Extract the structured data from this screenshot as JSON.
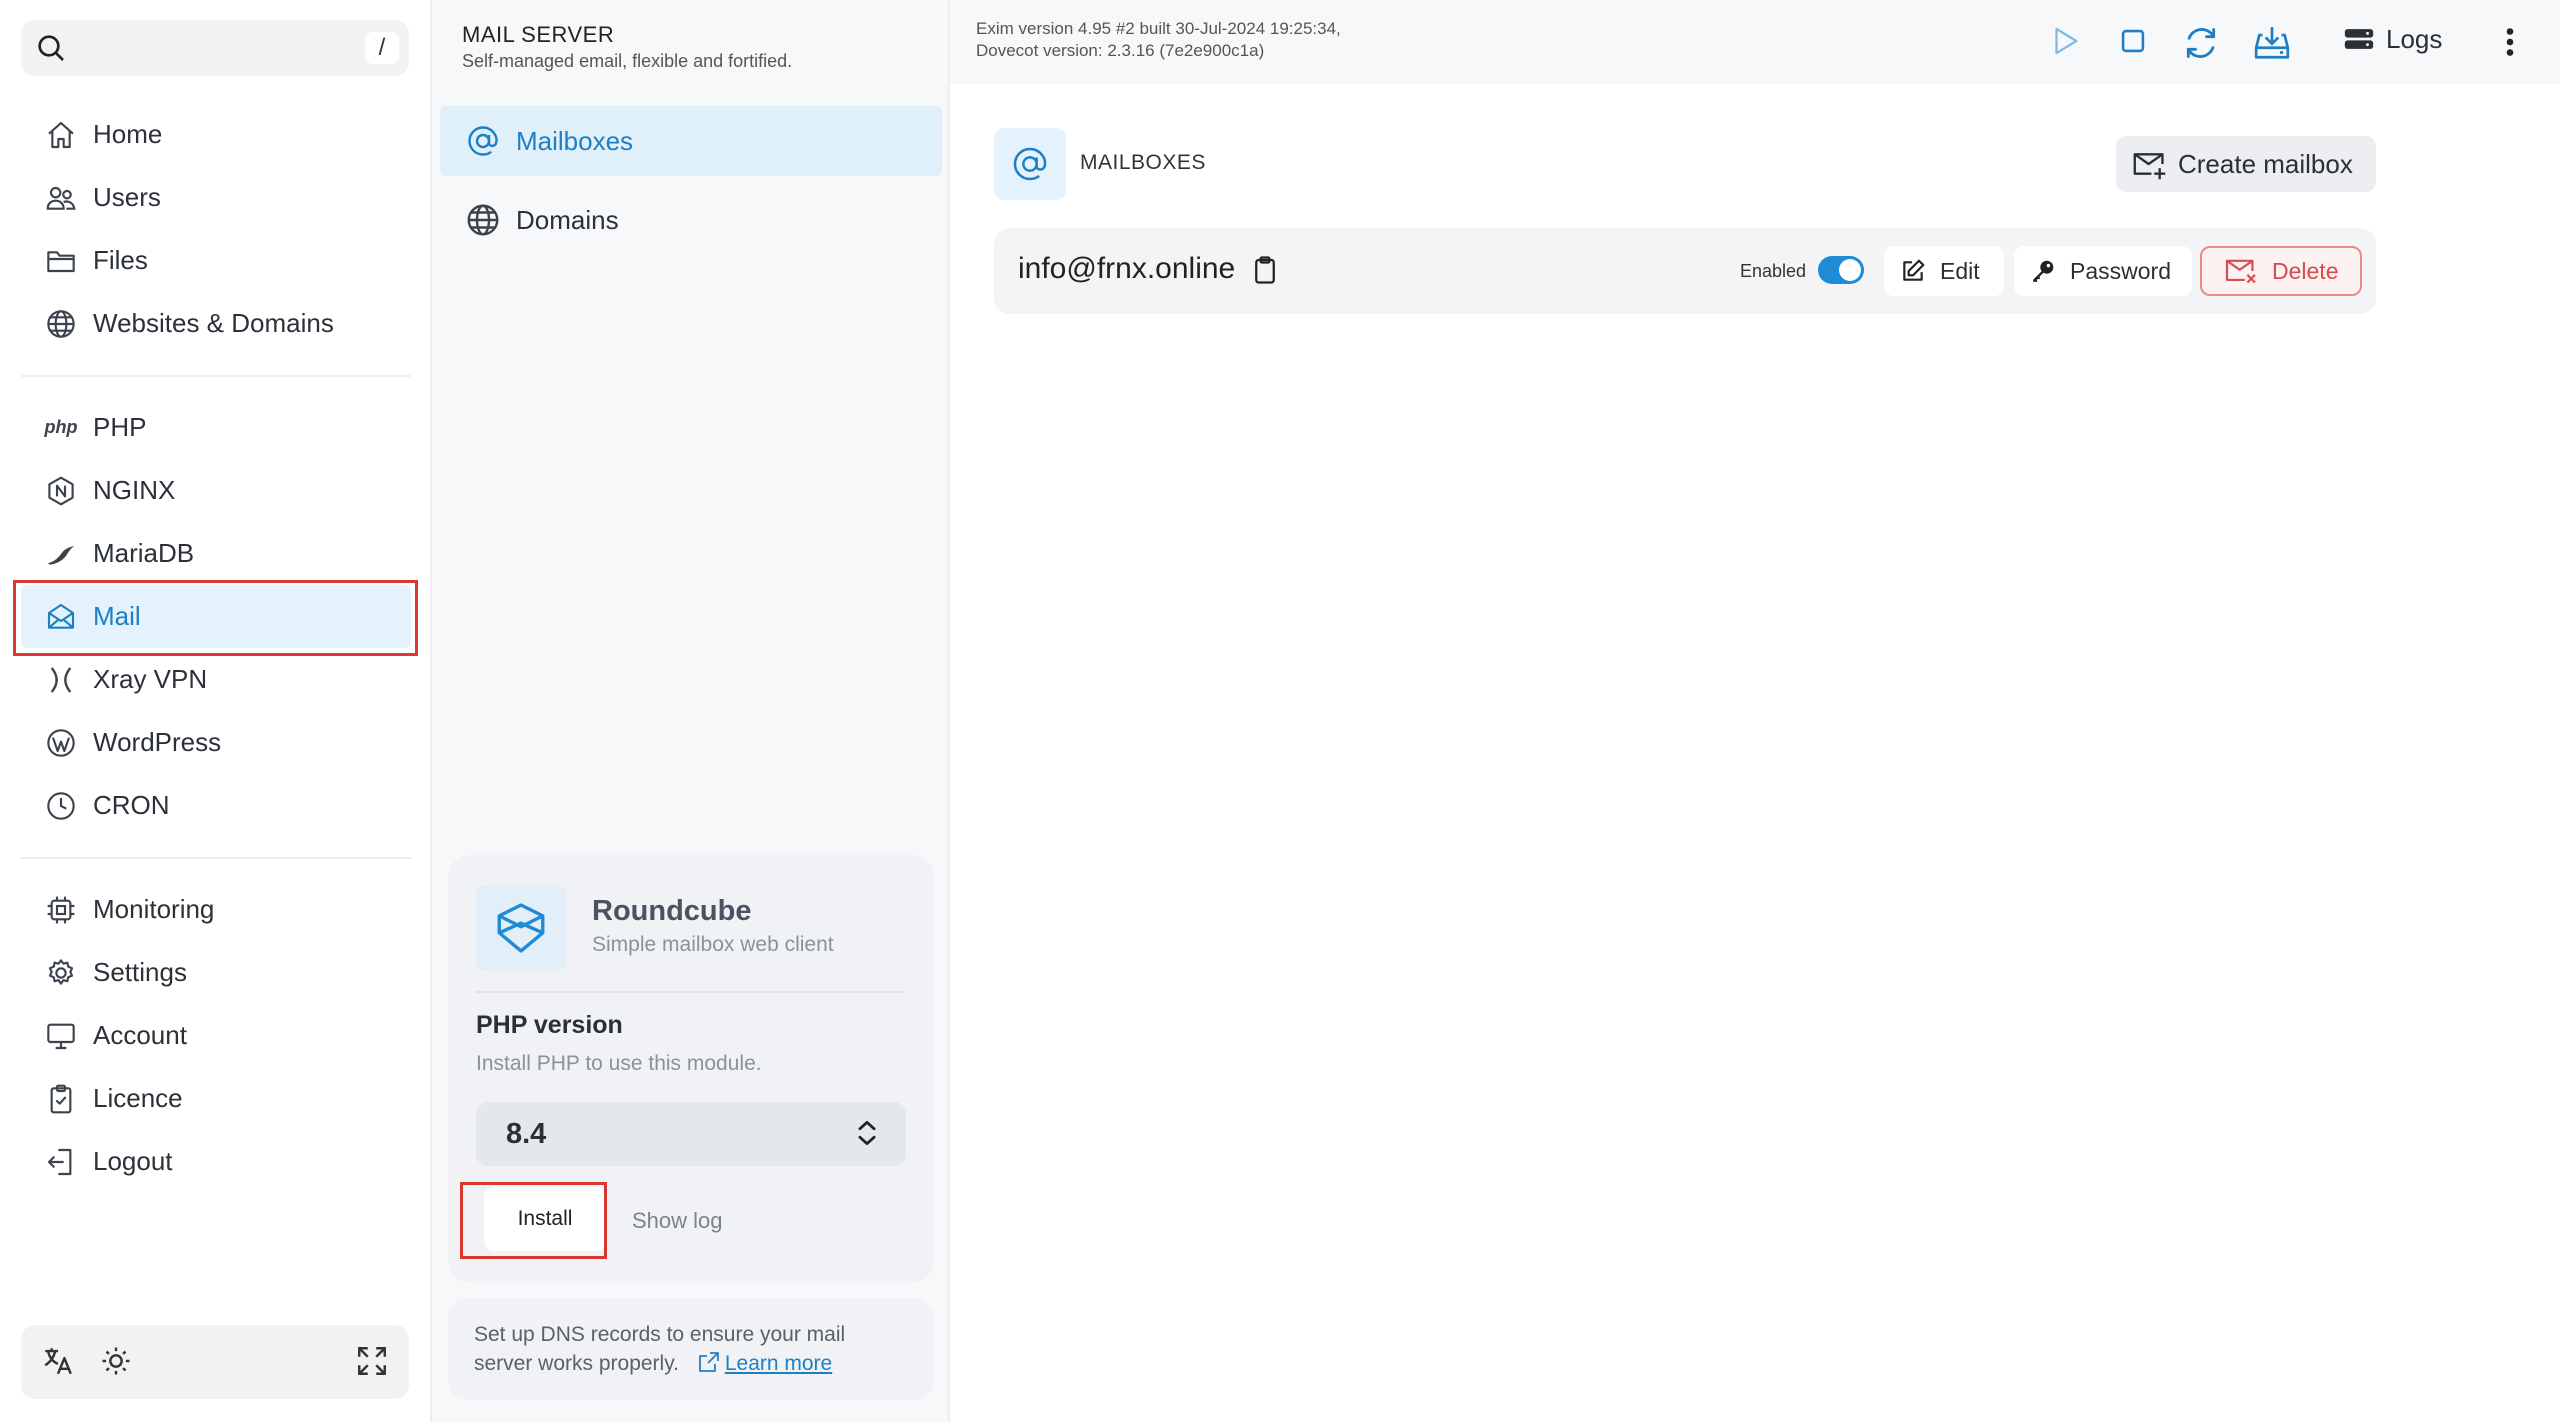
{
  "sidebar": {
    "search_shortcut": "/",
    "group1": [
      {
        "label": "Home",
        "icon": "home-icon"
      },
      {
        "label": "Users",
        "icon": "users-icon"
      },
      {
        "label": "Files",
        "icon": "folder-icon"
      },
      {
        "label": "Websites & Domains",
        "icon": "globe-icon"
      }
    ],
    "group2": [
      {
        "label": "PHP",
        "icon": "php-icon"
      },
      {
        "label": "NGINX",
        "icon": "nginx-icon"
      },
      {
        "label": "MariaDB",
        "icon": "mariadb-icon"
      },
      {
        "label": "Mail",
        "icon": "mail-icon",
        "active": true
      },
      {
        "label": "Xray VPN",
        "icon": "xray-icon"
      },
      {
        "label": "WordPress",
        "icon": "wordpress-icon"
      },
      {
        "label": "CRON",
        "icon": "clock-icon"
      }
    ],
    "group3": [
      {
        "label": "Monitoring",
        "icon": "chip-icon"
      },
      {
        "label": "Settings",
        "icon": "gear-icon"
      },
      {
        "label": "Account",
        "icon": "monitor-icon"
      },
      {
        "label": "Licence",
        "icon": "licence-icon"
      },
      {
        "label": "Logout",
        "icon": "logout-icon"
      }
    ],
    "php_glyph": "php"
  },
  "module": {
    "title": "MAIL SERVER",
    "subtitle": "Self-managed email, flexible and fortified.",
    "nav": [
      {
        "label": "Mailboxes",
        "icon": "at-icon",
        "active": true
      },
      {
        "label": "Domains",
        "icon": "globe-icon"
      }
    ]
  },
  "roundcube": {
    "name": "Roundcube",
    "description": "Simple mailbox web client",
    "php_label": "PHP version",
    "php_hint": "Install PHP to use this module.",
    "php_value": "8.4",
    "install_label": "Install",
    "log_label": "Show log"
  },
  "dns_notice": {
    "text": "Set up DNS records to ensure your mail server works properly.",
    "link": "Learn more"
  },
  "topbar": {
    "version_line1": "Exim version 4.95 #2 built 30-Jul-2024 19:25:34,",
    "version_line2": "Dovecot version: 2.3.16 (7e2e900c1a)",
    "logs_label": "Logs"
  },
  "mailboxes": {
    "heading": "MAILBOXES",
    "create_label": "Create mailbox",
    "rows": [
      {
        "email": "info@frnx.online",
        "enabled_label": "Enabled",
        "enabled": true,
        "edit_label": "Edit",
        "password_label": "Password",
        "delete_label": "Delete"
      }
    ]
  },
  "colors": {
    "accent": "#1f7fc4",
    "active_bg": "#e3f2fc",
    "danger": "#d64b4b",
    "highlight": "#d9382e"
  }
}
